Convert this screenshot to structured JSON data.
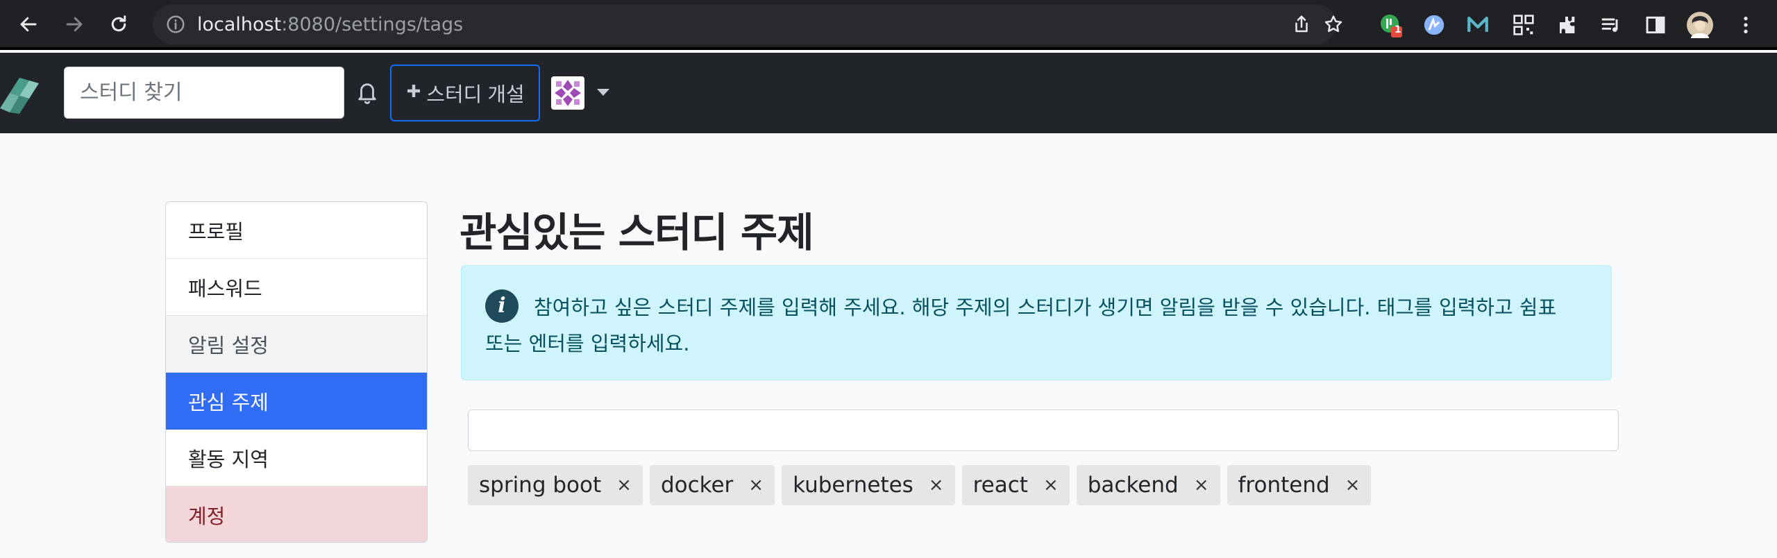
{
  "browser": {
    "url_host": "localhost",
    "url_path": ":8080/settings/tags",
    "ext_badge": "1"
  },
  "navbar": {
    "search_placeholder": "스터디 찾기",
    "open_study_label": "스터디 개설",
    "brand_color": "#316cf4"
  },
  "sidebar": {
    "items": [
      {
        "label": "프로필"
      },
      {
        "label": "패스워드"
      },
      {
        "label": "알림 설정"
      },
      {
        "label": "관심 주제"
      },
      {
        "label": "활동 지역"
      },
      {
        "label": "계정"
      }
    ]
  },
  "main": {
    "title": "관심있는 스터디 주제",
    "alert_line1": "참여하고 싶은 스터디 주제를 입력해 주세요. 해당 주제의 스터디가 생기면 알림을 받을 수 있습니다. 태그를 입력하고 쉼표",
    "alert_line2": "또는 엔터를 입력하세요.",
    "tags": [
      "spring boot",
      "docker",
      "kubernetes",
      "react",
      "backend",
      "frontend"
    ],
    "tag_remove_symbol": "×"
  }
}
